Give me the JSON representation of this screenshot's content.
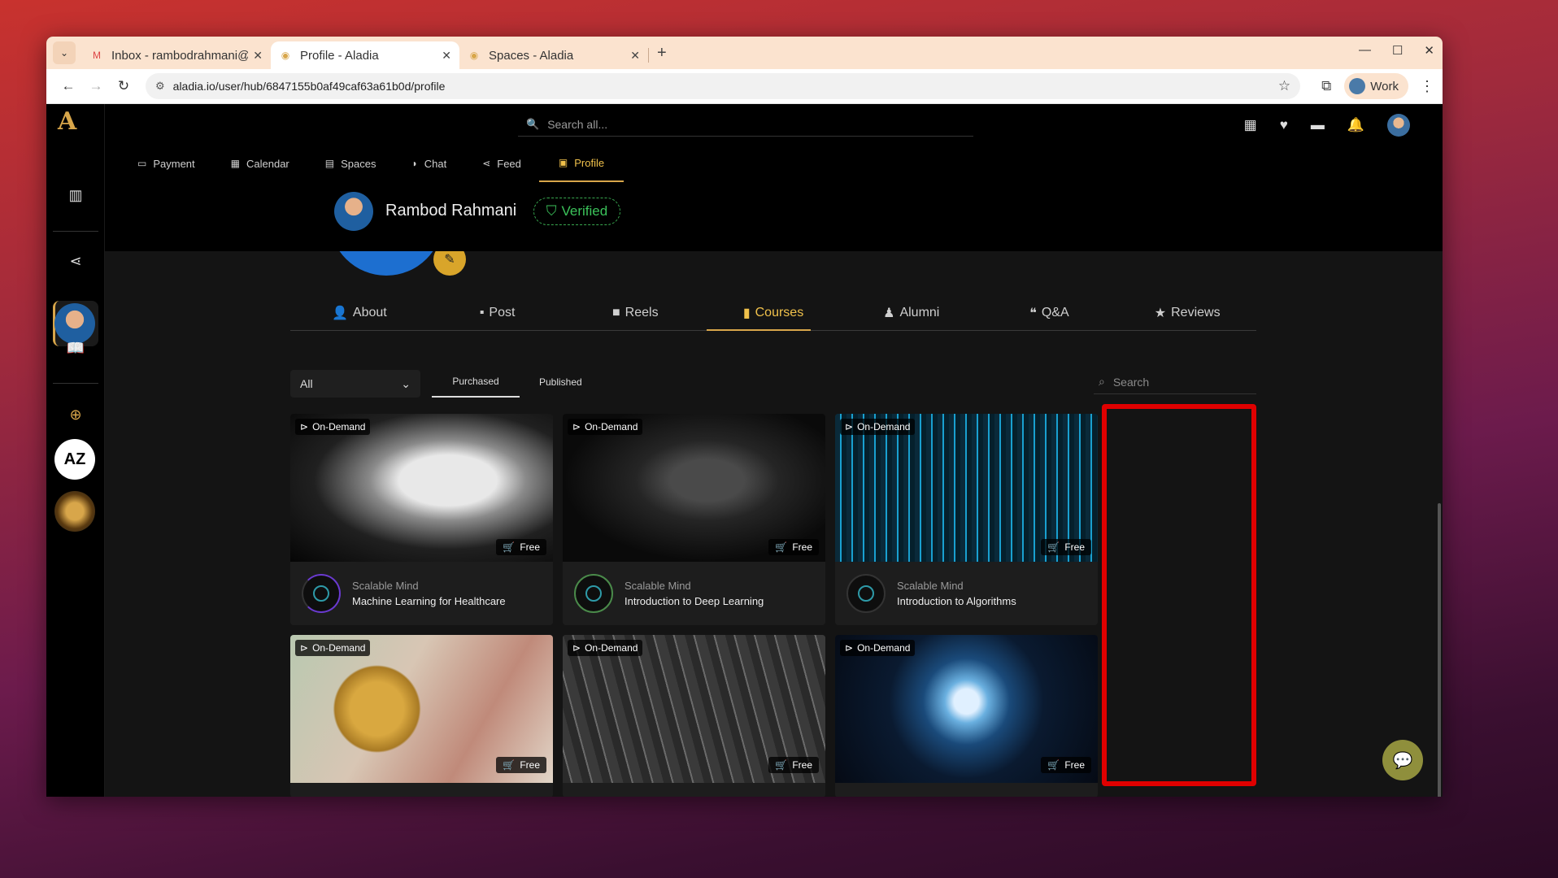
{
  "browser": {
    "tabs": [
      {
        "title": "Inbox - rambodrahmani@",
        "favicon": "gmail-icon",
        "active": false
      },
      {
        "title": "Profile - Aladia",
        "favicon": "aladia-icon",
        "active": true
      },
      {
        "title": "Spaces - Aladia",
        "favicon": "aladia-icon",
        "active": false
      }
    ],
    "url": "aladia.io/user/hub/6847155b0af49caf63a61b0d/profile",
    "profile_label": "Work"
  },
  "app": {
    "search_placeholder": "Search all...",
    "nav": [
      {
        "label": "Payment",
        "icon": "card-icon"
      },
      {
        "label": "Calendar",
        "icon": "calendar-icon"
      },
      {
        "label": "Spaces",
        "icon": "spaces-icon"
      },
      {
        "label": "Chat",
        "icon": "chat-icon"
      },
      {
        "label": "Feed",
        "icon": "share-icon"
      },
      {
        "label": "Profile",
        "icon": "profile-card-icon",
        "active": true
      }
    ],
    "rail_badge_text": "AZ"
  },
  "profile": {
    "name": "Rambod Rahmani",
    "verified_label": "Verified",
    "tabs": [
      {
        "label": "About",
        "icon": "user-icon"
      },
      {
        "label": "Post",
        "icon": "post-icon"
      },
      {
        "label": "Reels",
        "icon": "video-icon"
      },
      {
        "label": "Courses",
        "icon": "book-icon",
        "active": true
      },
      {
        "label": "Alumni",
        "icon": "alumni-icon"
      },
      {
        "label": "Q&A",
        "icon": "qa-icon"
      },
      {
        "label": "Reviews",
        "icon": "star-icon"
      }
    ],
    "filter_value": "All",
    "subtabs": [
      "Purchased",
      "Published"
    ],
    "search_placeholder": "Search"
  },
  "courses": [
    {
      "badge": "On-Demand",
      "price": "Free",
      "org": "Scalable Mind",
      "title": "Machine Learning for Healthcare"
    },
    {
      "badge": "On-Demand",
      "price": "Free",
      "org": "Scalable Mind",
      "title": "Introduction to Deep Learning"
    },
    {
      "badge": "On-Demand",
      "price": "Free",
      "org": "Scalable Mind",
      "title": "Introduction to Algorithms"
    },
    {
      "badge": "On-Demand",
      "price": "Free"
    },
    {
      "badge": "On-Demand",
      "price": "Free"
    },
    {
      "badge": "On-Demand",
      "price": "Free"
    }
  ],
  "colors": {
    "accent": "#d8a64a",
    "verified": "#3bc25a",
    "highlight": "#e00000"
  }
}
